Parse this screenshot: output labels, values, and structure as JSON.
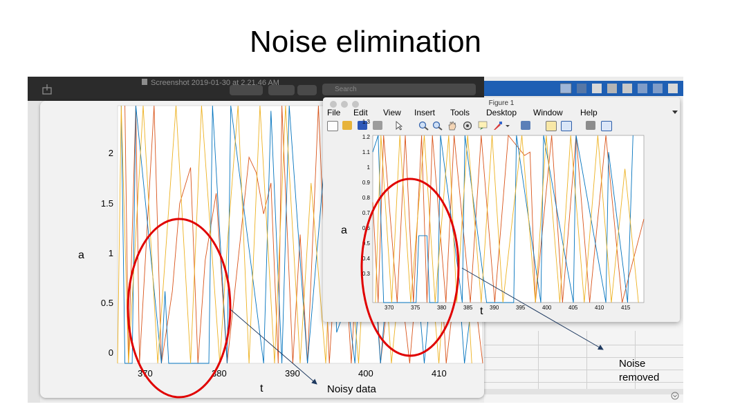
{
  "slide": {
    "title": "Noise elimination",
    "annotation_noisy": "Noisy data",
    "annotation_removed": "Noise removed"
  },
  "screenshot_app": {
    "window_title": "Screenshot 2019-01-30 at 2.21.46 AM",
    "search_placeholder": "Search"
  },
  "left_plot": {
    "ylabel": "a",
    "xlabel": "t",
    "y_ticks": [
      "2",
      "1.5",
      "1",
      "0.5",
      "0"
    ],
    "x_ticks": [
      "370",
      "380",
      "390",
      "400",
      "410"
    ]
  },
  "figure_window": {
    "title": "Figure 1",
    "menu": [
      "File",
      "Edit",
      "View",
      "Insert",
      "Tools",
      "Desktop",
      "Window",
      "Help"
    ],
    "ylabel": "a",
    "xlabel": "t",
    "y_ticks": [
      "1.3",
      "1.2",
      "1.1",
      "1",
      "0.9",
      "0.8",
      "0.7",
      "0.6",
      "0.5",
      "0.4",
      "0.3"
    ],
    "x_ticks": [
      "370",
      "375",
      "380",
      "385",
      "390",
      "395",
      "400",
      "405",
      "410",
      "415"
    ]
  },
  "colors": {
    "series_blue": "#0072bd",
    "series_orange": "#d95319",
    "series_yellow": "#edb120",
    "highlight": "#e00000",
    "arrow": "#1f3a60"
  }
}
